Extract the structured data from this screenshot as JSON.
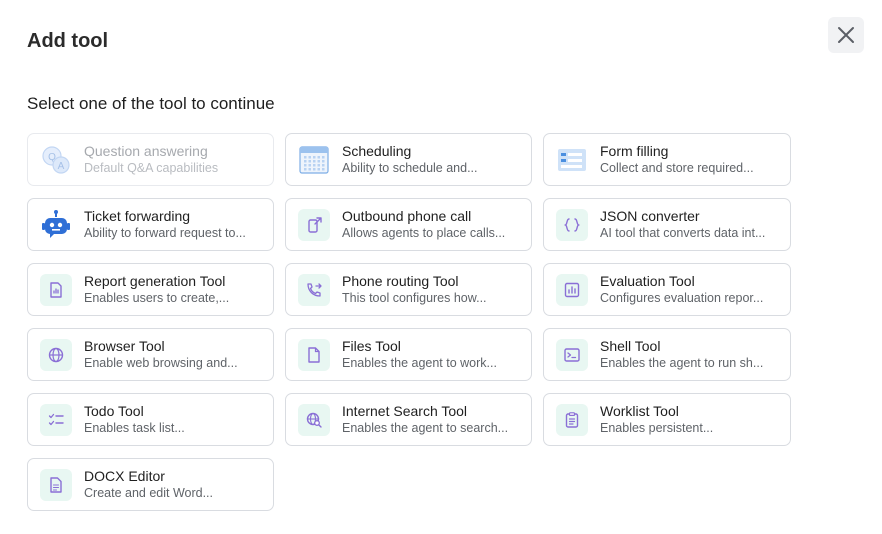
{
  "dialog": {
    "title": "Add tool",
    "subtitle": "Select one of the tool to continue",
    "close_icon": "close-icon"
  },
  "tools": [
    {
      "title": "Question answering",
      "desc": "Default Q&A capabilities",
      "icon": "qa-bubbles-icon",
      "disabled": true
    },
    {
      "title": "Scheduling",
      "desc": "Ability to schedule and...",
      "icon": "calendar-icon"
    },
    {
      "title": "Form filling",
      "desc": "Collect and store required...",
      "icon": "form-icon"
    },
    {
      "title": "Ticket forwarding",
      "desc": "Ability to forward request to...",
      "icon": "robot-icon"
    },
    {
      "title": "Outbound phone call",
      "desc": "Allows agents to place calls...",
      "icon": "outbound-call-icon"
    },
    {
      "title": "JSON converter",
      "desc": "AI tool that converts data int...",
      "icon": "braces-icon"
    },
    {
      "title": "Report generation Tool",
      "desc": "Enables users to create,...",
      "icon": "report-icon"
    },
    {
      "title": "Phone routing Tool",
      "desc": "This tool configures how...",
      "icon": "phone-forward-icon"
    },
    {
      "title": "Evaluation Tool",
      "desc": "Configures evaluation repor...",
      "icon": "bar-chart-icon"
    },
    {
      "title": "Browser Tool",
      "desc": "Enable web browsing and...",
      "icon": "globe-icon"
    },
    {
      "title": "Files Tool",
      "desc": "Enables the agent to work...",
      "icon": "file-icon"
    },
    {
      "title": "Shell Tool",
      "desc": "Enables the agent to run sh...",
      "icon": "terminal-icon"
    },
    {
      "title": "Todo Tool",
      "desc": "Enables task list...",
      "icon": "checklist-icon"
    },
    {
      "title": "Internet Search Tool",
      "desc": "Enables the agent to search...",
      "icon": "web-search-icon"
    },
    {
      "title": "Worklist Tool",
      "desc": "Enables persistent...",
      "icon": "clipboard-icon"
    },
    {
      "title": "DOCX Editor",
      "desc": "Create and edit Word...",
      "icon": "document-icon"
    }
  ],
  "colors": {
    "icon_accent": "#8a6fd6",
    "icon_bg": "#e8f7f2",
    "illustration_blue": "#4a8fe0"
  }
}
